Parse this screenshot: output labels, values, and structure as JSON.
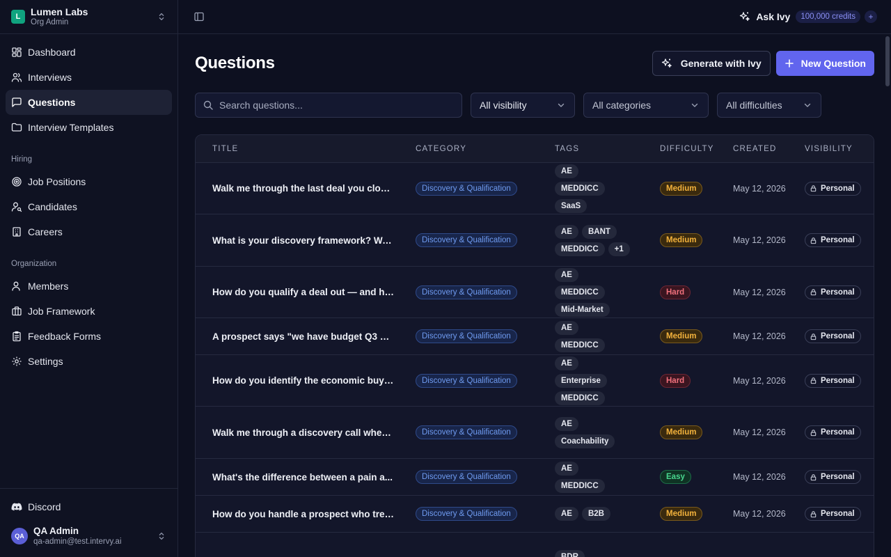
{
  "org": {
    "initial": "L",
    "name": "Lumen Labs",
    "role": "Org Admin"
  },
  "nav": {
    "items": [
      {
        "label": "Dashboard",
        "icon": "dashboard-icon"
      },
      {
        "label": "Interviews",
        "icon": "users-icon"
      },
      {
        "label": "Questions",
        "icon": "message-square-icon",
        "active": true
      },
      {
        "label": "Interview Templates",
        "icon": "folder-icon"
      }
    ],
    "hiring_title": "Hiring",
    "hiring": [
      {
        "label": "Job Positions",
        "icon": "target-icon"
      },
      {
        "label": "Candidates",
        "icon": "user-search-icon"
      },
      {
        "label": "Careers",
        "icon": "building-icon"
      }
    ],
    "org_title": "Organization",
    "organization": [
      {
        "label": "Members",
        "icon": "user-icon"
      },
      {
        "label": "Job Framework",
        "icon": "briefcase-icon"
      },
      {
        "label": "Feedback Forms",
        "icon": "clipboard-icon"
      },
      {
        "label": "Settings",
        "icon": "gear-icon"
      }
    ]
  },
  "sidebar_bottom": {
    "discord": "Discord",
    "user": {
      "initials": "QA",
      "name": "QA Admin",
      "email": "qa-admin@test.intervy.ai"
    }
  },
  "topbar": {
    "ask_ivy": "Ask Ivy",
    "credits": "100,000 credits",
    "plus": "+"
  },
  "page": {
    "title": "Questions",
    "generate_label": "Generate with Ivy",
    "new_label": "New Question"
  },
  "filters": {
    "search_placeholder": "Search questions...",
    "visibility": "All visibility",
    "categories": "All categories",
    "difficulties": "All difficulties"
  },
  "table": {
    "headers": [
      "TITLE",
      "CATEGORY",
      "TAGS",
      "DIFFICULTY",
      "CREATED",
      "VISIBILITY"
    ],
    "rows": [
      {
        "title": "Walk me through the last deal you close...",
        "category": "Discovery & Qualification",
        "tags": [
          "AE",
          "MEDDICC",
          "SaaS"
        ],
        "difficulty": "Medium",
        "created": "May 12, 2026",
        "visibility": "Personal"
      },
      {
        "title": "What is your discovery framework? Wal...",
        "category": "Discovery & Qualification",
        "tags": [
          "AE",
          "BANT",
          "MEDDICC",
          "+1"
        ],
        "difficulty": "Medium",
        "created": "May 12, 2026",
        "visibility": "Personal"
      },
      {
        "title": "How do you qualify a deal out — and ho...",
        "category": "Discovery & Qualification",
        "tags": [
          "AE",
          "MEDDICC",
          "Mid-Market"
        ],
        "difficulty": "Hard",
        "created": "May 12, 2026",
        "visibility": "Personal"
      },
      {
        "title": "A prospect says \"we have budget Q3 bu...",
        "category": "Discovery & Qualification",
        "tags": [
          "AE",
          "MEDDICC"
        ],
        "difficulty": "Medium",
        "created": "May 12, 2026",
        "visibility": "Personal"
      },
      {
        "title": "How do you identify the economic buyer...",
        "category": "Discovery & Qualification",
        "tags": [
          "AE",
          "Enterprise",
          "MEDDICC"
        ],
        "difficulty": "Hard",
        "created": "May 12, 2026",
        "visibility": "Personal"
      },
      {
        "title": "Walk me through a discovery call where ...",
        "category": "Discovery & Qualification",
        "tags": [
          "AE",
          "Coachability"
        ],
        "difficulty": "Medium",
        "created": "May 12, 2026",
        "visibility": "Personal"
      },
      {
        "title": "What's the difference between a pain a...",
        "category": "Discovery & Qualification",
        "tags": [
          "AE",
          "MEDDICC"
        ],
        "difficulty": "Easy",
        "created": "May 12, 2026",
        "visibility": "Personal"
      },
      {
        "title": "How do you handle a prospect who trea...",
        "category": "Discovery & Qualification",
        "tags": [
          "AE",
          "B2B"
        ],
        "difficulty": "Medium",
        "created": "May 12, 2026",
        "visibility": "Personal"
      },
      {
        "title": "",
        "category": "",
        "tags": [
          "BDR"
        ],
        "difficulty": "",
        "created": "",
        "visibility": ""
      }
    ]
  }
}
